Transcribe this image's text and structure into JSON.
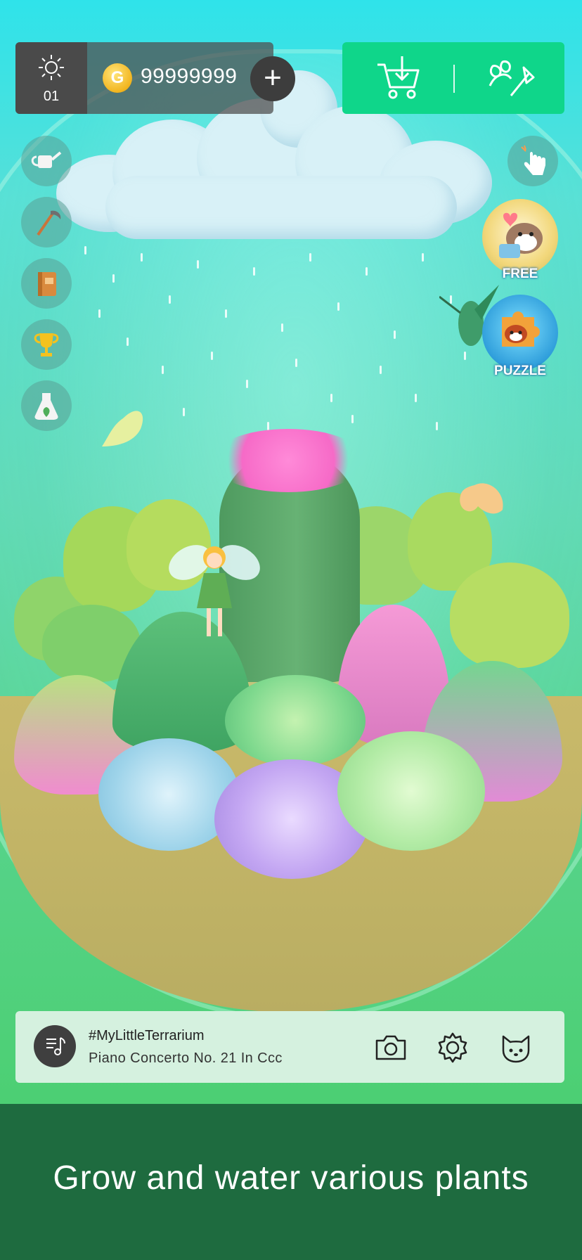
{
  "hud": {
    "level": "01",
    "coin_symbol": "G",
    "coins": "99999999",
    "add_coins_symbol": "+"
  },
  "sidebar": {
    "items": [
      {
        "name": "watering-can-icon"
      },
      {
        "name": "scythe-icon"
      },
      {
        "name": "book-icon"
      },
      {
        "name": "trophy-icon"
      },
      {
        "name": "flask-plant-icon"
      }
    ]
  },
  "promos": {
    "free_label": "FREE",
    "puzzle_label": "PUZZLE"
  },
  "music": {
    "tag": "#MyLittleTerrarium",
    "title": "Piano Concerto No. 21 In Ccc"
  },
  "caption": {
    "text": "Grow and water various plants"
  },
  "colors": {
    "accent_green": "#0fd68a",
    "hud_dark": "#4a4a4a",
    "caption_bg": "#1e6b3f",
    "coin": "#f2b51f"
  }
}
